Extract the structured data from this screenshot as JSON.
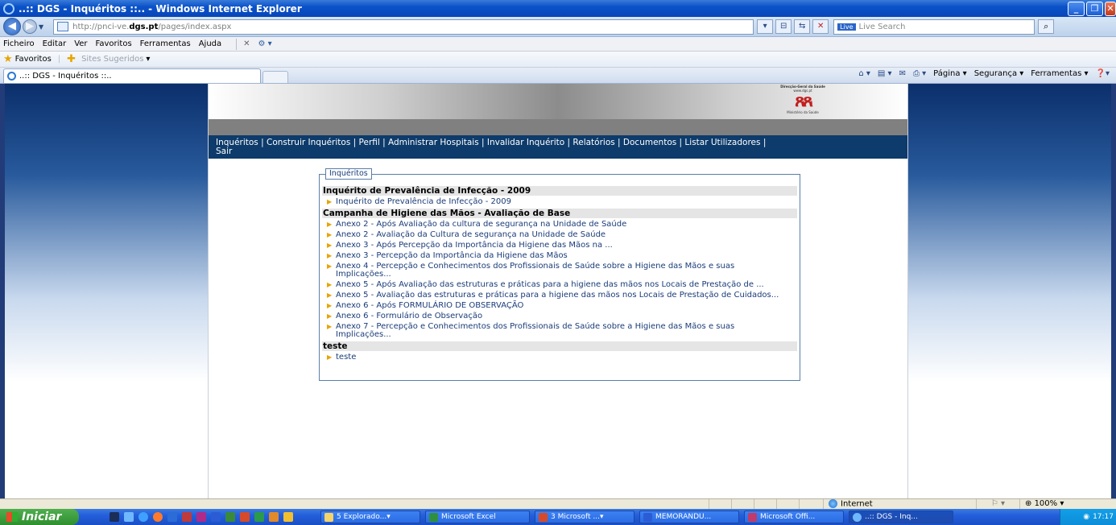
{
  "window": {
    "title": "..:: DGS - Inquéritos ::.. - Windows Internet Explorer"
  },
  "address": {
    "url_prefix": "http://pnci-ve.",
    "url_domain": "dgs.pt",
    "url_path": "/pages/index.aspx",
    "search_placeholder": "Live Search",
    "search_logo": "Live"
  },
  "menu": [
    "Ficheiro",
    "Editar",
    "Ver",
    "Favoritos",
    "Ferramentas",
    "Ajuda"
  ],
  "favorites": {
    "label": "Favoritos",
    "suggested": "Sites Sugeridos"
  },
  "tab": {
    "label": "..:: DGS - Inquéritos ::.."
  },
  "commandbar": {
    "page": "Página",
    "security": "Segurança",
    "tools": "Ferramentas"
  },
  "site": {
    "logo_top": "Direcção-Geral da Saúde",
    "logo_url": "www.dgs.pt",
    "logo_bottom": "Ministério da Saúde",
    "nav_line1": "Inquéritos | Construir Inquéritos | Perfil | Administrar Hospitais | Invalidar Inquérito | Relatórios | Documentos | Listar Utilizadores |",
    "nav_line2": "Sair",
    "legend": "Inquéritos",
    "sections": [
      {
        "title": "Inquérito de Prevalência de Infecção - 2009",
        "items": [
          "Inquérito de Prevalência de Infecção - 2009"
        ]
      },
      {
        "title": "Campanha de Higiene das Mãos - Avaliação de Base",
        "items": [
          "Anexo 2 - Após Avaliação da cultura de segurança na Unidade de Saúde",
          "Anexo 2 - Avaliação da Cultura de segurança na Unidade de Saúde",
          "Anexo 3 - Após Percepção da Importância da Higiene das Mãos na ...",
          "Anexo 3 - Percepção da Importância da Higiene das Mãos",
          "Anexo 4 - Percepção e Conhecimentos dos Profissionais de Saúde sobre a Higiene das Mãos e suas Implicações...",
          "Anexo 5 - Após Avaliação das estruturas e práticas para a higiene das mãos nos Locais de Prestação de ...",
          "Anexo 5 - Avaliação das estruturas e práticas para a higiene das mãos nos Locais de Prestação de Cuidados...",
          "Anexo 6 - Após FORMULÁRIO DE OBSERVAÇÃO",
          "Anexo 6 - Formulário de Observação",
          "Anexo 7 - Percepção e Conhecimentos dos Profissionais de Saúde sobre a Higiene das Mãos e suas Implicações..."
        ]
      },
      {
        "title": "teste",
        "items": [
          "teste"
        ]
      }
    ]
  },
  "status": {
    "zone": "Internet",
    "zoom": "100%"
  },
  "taskbar": {
    "start": "Iniciar",
    "tasks": [
      "5 Explorado...",
      "Microsoft Excel",
      "3 Microsoft ...",
      "MEMORANDU...",
      "Microsoft Offi...",
      "..:: DGS - Inq..."
    ],
    "clock": "17:17"
  }
}
